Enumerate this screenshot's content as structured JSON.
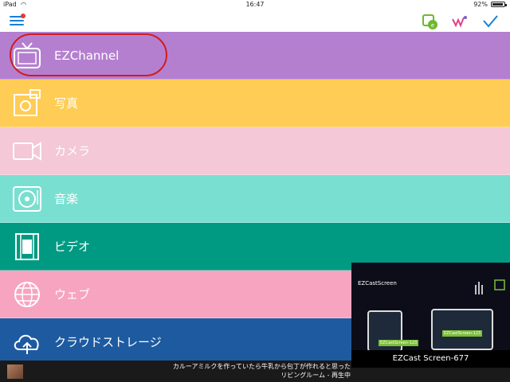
{
  "status_bar": {
    "device": "iPad",
    "time": "16:47",
    "battery": "92%"
  },
  "menu": [
    {
      "label": "EZChannel",
      "icon": "tv-icon",
      "color": "#b57fd0"
    },
    {
      "label": "写真",
      "icon": "photo-icon",
      "color": "#ffcc55"
    },
    {
      "label": "カメラ",
      "icon": "camera-icon",
      "color": "#f4c8d6"
    },
    {
      "label": "音楽",
      "icon": "music-icon",
      "color": "#79dfd1"
    },
    {
      "label": "ビデオ",
      "icon": "video-icon",
      "color": "#009a82"
    },
    {
      "label": "ウェブ",
      "icon": "web-icon",
      "color": "#f7a4c0"
    },
    {
      "label": "クラウドストレージ",
      "icon": "cloud-icon",
      "color": "#1e5aa0"
    }
  ],
  "now_playing": {
    "line1": "カルーアミルクを作っていたら牛乳から包丁が作れると思った",
    "line2": "リビングルーム - 再生中"
  },
  "preview": {
    "title": "EZCastScreen",
    "device_a": "EZCastScreen-123",
    "device_b": "EZCastScreen-123",
    "caption": "EZCast Screen-677"
  }
}
